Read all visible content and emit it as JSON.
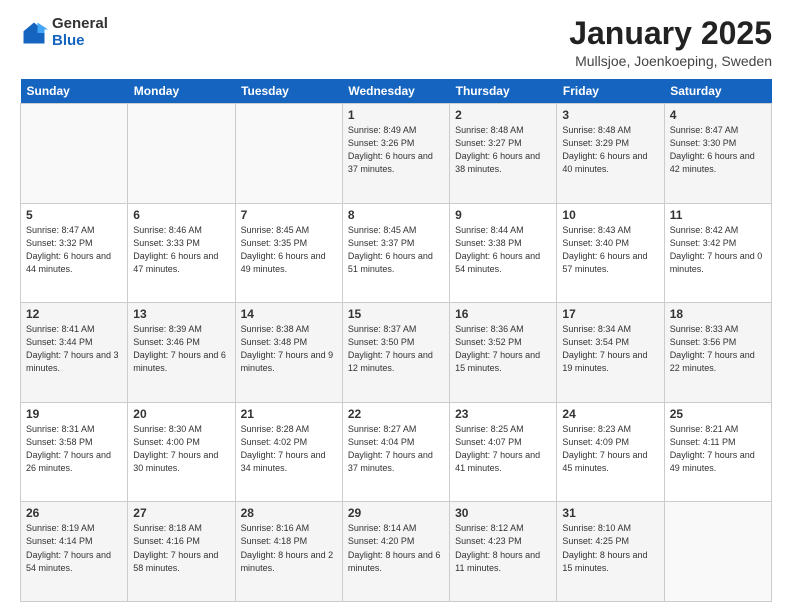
{
  "header": {
    "logo_general": "General",
    "logo_blue": "Blue",
    "title": "January 2025",
    "subtitle": "Mullsjoe, Joenkoeping, Sweden"
  },
  "days_of_week": [
    "Sunday",
    "Monday",
    "Tuesday",
    "Wednesday",
    "Thursday",
    "Friday",
    "Saturday"
  ],
  "weeks": [
    [
      {
        "num": "",
        "info": ""
      },
      {
        "num": "",
        "info": ""
      },
      {
        "num": "",
        "info": ""
      },
      {
        "num": "1",
        "info": "Sunrise: 8:49 AM\nSunset: 3:26 PM\nDaylight: 6 hours\nand 37 minutes."
      },
      {
        "num": "2",
        "info": "Sunrise: 8:48 AM\nSunset: 3:27 PM\nDaylight: 6 hours\nand 38 minutes."
      },
      {
        "num": "3",
        "info": "Sunrise: 8:48 AM\nSunset: 3:29 PM\nDaylight: 6 hours\nand 40 minutes."
      },
      {
        "num": "4",
        "info": "Sunrise: 8:47 AM\nSunset: 3:30 PM\nDaylight: 6 hours\nand 42 minutes."
      }
    ],
    [
      {
        "num": "5",
        "info": "Sunrise: 8:47 AM\nSunset: 3:32 PM\nDaylight: 6 hours\nand 44 minutes."
      },
      {
        "num": "6",
        "info": "Sunrise: 8:46 AM\nSunset: 3:33 PM\nDaylight: 6 hours\nand 47 minutes."
      },
      {
        "num": "7",
        "info": "Sunrise: 8:45 AM\nSunset: 3:35 PM\nDaylight: 6 hours\nand 49 minutes."
      },
      {
        "num": "8",
        "info": "Sunrise: 8:45 AM\nSunset: 3:37 PM\nDaylight: 6 hours\nand 51 minutes."
      },
      {
        "num": "9",
        "info": "Sunrise: 8:44 AM\nSunset: 3:38 PM\nDaylight: 6 hours\nand 54 minutes."
      },
      {
        "num": "10",
        "info": "Sunrise: 8:43 AM\nSunset: 3:40 PM\nDaylight: 6 hours\nand 57 minutes."
      },
      {
        "num": "11",
        "info": "Sunrise: 8:42 AM\nSunset: 3:42 PM\nDaylight: 7 hours\nand 0 minutes."
      }
    ],
    [
      {
        "num": "12",
        "info": "Sunrise: 8:41 AM\nSunset: 3:44 PM\nDaylight: 7 hours\nand 3 minutes."
      },
      {
        "num": "13",
        "info": "Sunrise: 8:39 AM\nSunset: 3:46 PM\nDaylight: 7 hours\nand 6 minutes."
      },
      {
        "num": "14",
        "info": "Sunrise: 8:38 AM\nSunset: 3:48 PM\nDaylight: 7 hours\nand 9 minutes."
      },
      {
        "num": "15",
        "info": "Sunrise: 8:37 AM\nSunset: 3:50 PM\nDaylight: 7 hours\nand 12 minutes."
      },
      {
        "num": "16",
        "info": "Sunrise: 8:36 AM\nSunset: 3:52 PM\nDaylight: 7 hours\nand 15 minutes."
      },
      {
        "num": "17",
        "info": "Sunrise: 8:34 AM\nSunset: 3:54 PM\nDaylight: 7 hours\nand 19 minutes."
      },
      {
        "num": "18",
        "info": "Sunrise: 8:33 AM\nSunset: 3:56 PM\nDaylight: 7 hours\nand 22 minutes."
      }
    ],
    [
      {
        "num": "19",
        "info": "Sunrise: 8:31 AM\nSunset: 3:58 PM\nDaylight: 7 hours\nand 26 minutes."
      },
      {
        "num": "20",
        "info": "Sunrise: 8:30 AM\nSunset: 4:00 PM\nDaylight: 7 hours\nand 30 minutes."
      },
      {
        "num": "21",
        "info": "Sunrise: 8:28 AM\nSunset: 4:02 PM\nDaylight: 7 hours\nand 34 minutes."
      },
      {
        "num": "22",
        "info": "Sunrise: 8:27 AM\nSunset: 4:04 PM\nDaylight: 7 hours\nand 37 minutes."
      },
      {
        "num": "23",
        "info": "Sunrise: 8:25 AM\nSunset: 4:07 PM\nDaylight: 7 hours\nand 41 minutes."
      },
      {
        "num": "24",
        "info": "Sunrise: 8:23 AM\nSunset: 4:09 PM\nDaylight: 7 hours\nand 45 minutes."
      },
      {
        "num": "25",
        "info": "Sunrise: 8:21 AM\nSunset: 4:11 PM\nDaylight: 7 hours\nand 49 minutes."
      }
    ],
    [
      {
        "num": "26",
        "info": "Sunrise: 8:19 AM\nSunset: 4:14 PM\nDaylight: 7 hours\nand 54 minutes."
      },
      {
        "num": "27",
        "info": "Sunrise: 8:18 AM\nSunset: 4:16 PM\nDaylight: 7 hours\nand 58 minutes."
      },
      {
        "num": "28",
        "info": "Sunrise: 8:16 AM\nSunset: 4:18 PM\nDaylight: 8 hours\nand 2 minutes."
      },
      {
        "num": "29",
        "info": "Sunrise: 8:14 AM\nSunset: 4:20 PM\nDaylight: 8 hours\nand 6 minutes."
      },
      {
        "num": "30",
        "info": "Sunrise: 8:12 AM\nSunset: 4:23 PM\nDaylight: 8 hours\nand 11 minutes."
      },
      {
        "num": "31",
        "info": "Sunrise: 8:10 AM\nSunset: 4:25 PM\nDaylight: 8 hours\nand 15 minutes."
      },
      {
        "num": "",
        "info": ""
      }
    ]
  ]
}
